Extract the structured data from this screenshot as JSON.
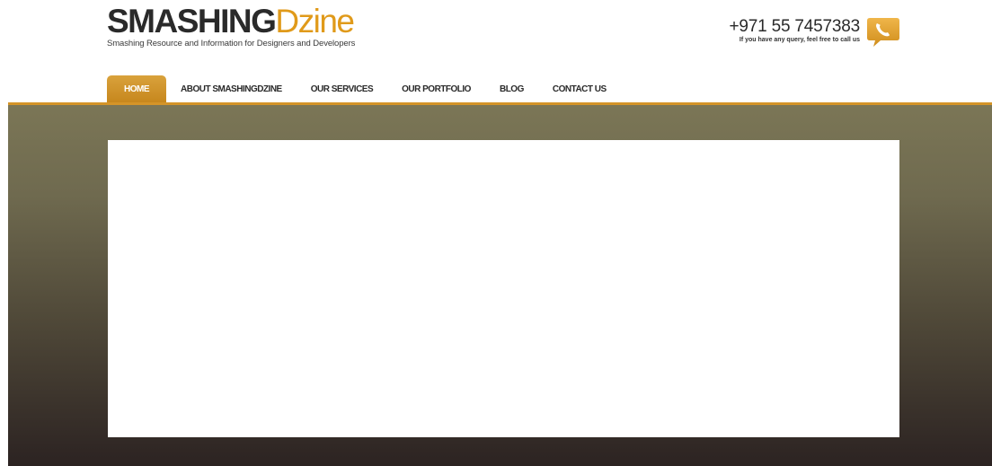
{
  "logo": {
    "title_part1": "SMASHING",
    "title_part2": "Dzine",
    "tagline": "Smashing Resource and Information for Designers and Developers"
  },
  "contact": {
    "phone": "+971 55 7457383",
    "note": "If you have any query, feel free to call us",
    "icon": "phone-chat-icon"
  },
  "nav": {
    "items": [
      {
        "label": "HOME",
        "active": true
      },
      {
        "label": "ABOUT SMASHINGDZINE",
        "active": false
      },
      {
        "label": "OUR SERVICES",
        "active": false
      },
      {
        "label": "OUR PORTFOLIO",
        "active": false
      },
      {
        "label": "BLOG",
        "active": false
      },
      {
        "label": "CONTACT US",
        "active": false
      }
    ]
  },
  "colors": {
    "accent": "#d49428",
    "hero_top": "#7b7656",
    "hero_bottom": "#2c2322",
    "text_dark": "#2a2a2a"
  }
}
